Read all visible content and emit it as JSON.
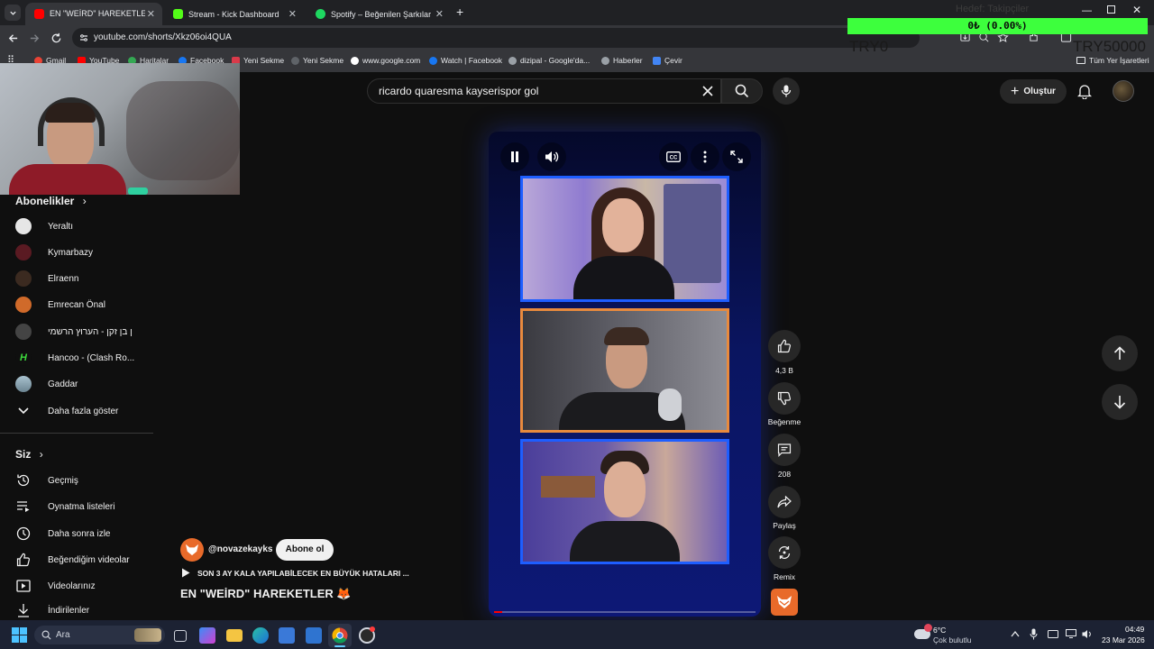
{
  "browser": {
    "tabs": [
      {
        "title": "EN \"WEİRD\" HAREKETLER 🦊",
        "favicon_color": "#ff0000"
      },
      {
        "title": "Stream - Kick Dashboard",
        "favicon_color": "#53fc18"
      },
      {
        "title": "Spotify – Beğenilen Şarkılar",
        "favicon_color": "#1ed760"
      }
    ],
    "new_tab_glyph": "+",
    "url": "youtube.com/shorts/Xkz06oi4QUA",
    "bookmarks": [
      {
        "label": "Gmail"
      },
      {
        "label": "YouTube"
      },
      {
        "label": "Haritalar"
      },
      {
        "label": "Facebook"
      },
      {
        "label": "Yeni Sekme"
      },
      {
        "label": "Yeni Sekme"
      },
      {
        "label": "www.google.com"
      },
      {
        "label": "Watch | Facebook"
      },
      {
        "label": "dizipal - Google'da..."
      },
      {
        "label": "Haberler"
      },
      {
        "label": "Çevir"
      }
    ],
    "all_bookmarks": "Tüm Yer İşaretleri"
  },
  "overlay": {
    "progress_text": "0₺ (0.00%)",
    "left_label": "TRY0",
    "right_label": "TRY50000",
    "ghost_text": "Hedef: Takipçiler"
  },
  "youtube": {
    "search_query": "ricardo quaresma kayserispor gol",
    "create_label": "Oluştur",
    "subscriptions_title": "Abonelikler",
    "subscriptions": [
      {
        "name": "Yeraltı",
        "color": "#e6e6e6"
      },
      {
        "name": "Kymarbazy",
        "color": "#5a1a22"
      },
      {
        "name": "Elraenn",
        "color": "#3b2a20"
      },
      {
        "name": "Emrecan Önal",
        "color": "#d06a2a"
      },
      {
        "name": "ן בן זקן - הערוץ הרשמי",
        "color": "#444444"
      },
      {
        "name": "Hancoo - (Clash Ro...",
        "color": "#1c7a1c"
      },
      {
        "name": "Gaddar",
        "color": "#8fa7b3"
      }
    ],
    "show_more": "Daha fazla göster",
    "you_title": "Siz",
    "you_items": [
      {
        "label": "Geçmiş",
        "icon": "history-icon"
      },
      {
        "label": "Oynatma listeleri",
        "icon": "playlist-icon"
      },
      {
        "label": "Daha sonra izle",
        "icon": "clock-icon"
      },
      {
        "label": "Beğendiğim videolar",
        "icon": "thumb-up-icon"
      },
      {
        "label": "Videolarınız",
        "icon": "video-icon"
      },
      {
        "label": "İndirilenler",
        "icon": "download-icon"
      }
    ],
    "short": {
      "channel": "@novazekayks",
      "subscribe": "Abone ol",
      "linked_video": "SON 3 AY KALA YAPILABİLECEK EN BÜYÜK HATALARI ...",
      "title": "EN \"WEİRD\" HAREKETLER 🦊",
      "likes": "4,3 B",
      "dislike_label": "Beğenme",
      "comments": "208",
      "share_label": "Paylaş",
      "remix_label": "Remix"
    }
  },
  "taskbar": {
    "search_placeholder": "Ara",
    "weather_temp": "6°C",
    "weather_desc": "Çok bulutlu",
    "time": "04:49",
    "date": "23 Mar 2026"
  }
}
